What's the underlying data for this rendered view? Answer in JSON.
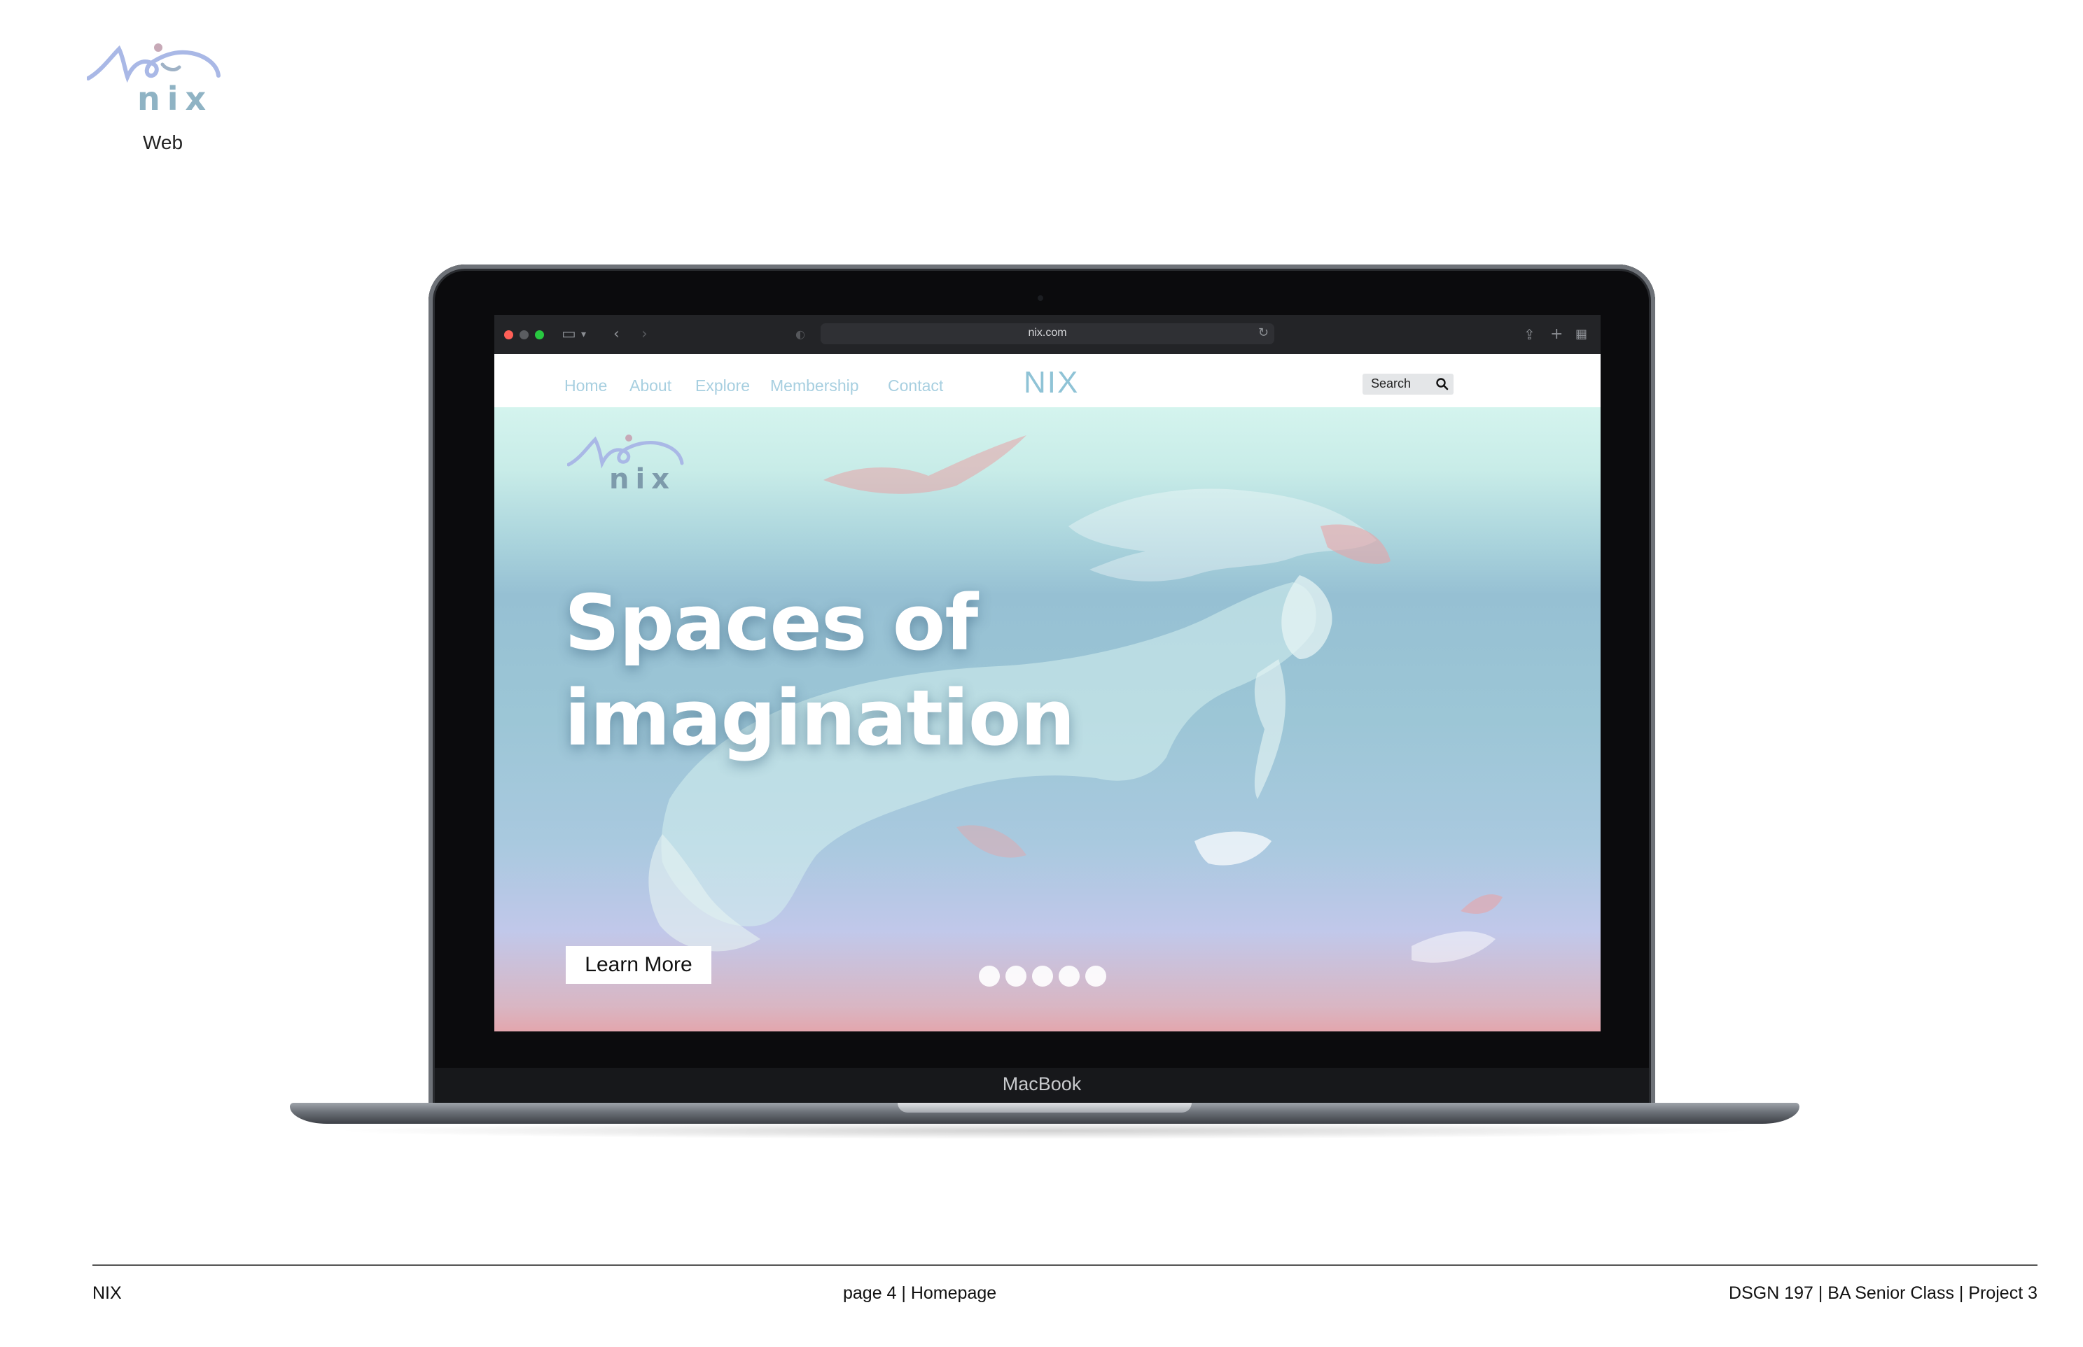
{
  "corner_logo": {
    "wordmark": "nix",
    "label": "Web"
  },
  "browser": {
    "url": "nix.com",
    "traffic_colors": [
      "#ff5f57",
      "#5b5d61",
      "#28c840"
    ]
  },
  "site": {
    "nav": [
      "Home",
      "About",
      "Explore",
      "Membership",
      "Contact"
    ],
    "title": "NIX",
    "search_label": "Search"
  },
  "hero": {
    "logo_wordmark": "nix",
    "headline_line1": "Spaces of",
    "headline_line2": "imagination",
    "cta_label": "Learn More",
    "carousel_dot_count": 5
  },
  "laptop": {
    "brand": "MacBook"
  },
  "footer": {
    "left": "NIX",
    "center": "page 4  | Homepage",
    "right": "DSGN 197 | BA Senior Class | Project 3"
  }
}
